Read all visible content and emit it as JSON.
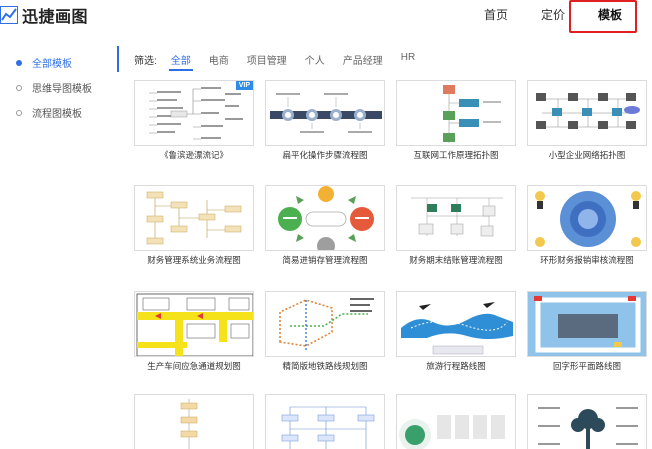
{
  "header": {
    "logo_text": "迅捷画图",
    "nav": {
      "home": "首页",
      "pricing": "定价",
      "templates": "模板"
    }
  },
  "sidebar": {
    "items": [
      {
        "label": "全部模板",
        "active": true
      },
      {
        "label": "思维导图模板",
        "active": false
      },
      {
        "label": "流程图模板",
        "active": false
      }
    ]
  },
  "filter": {
    "label": "筛选:",
    "tabs": [
      "全部",
      "电商",
      "项目管理",
      "个人",
      "产品经理",
      "HR"
    ],
    "active_index": 0
  },
  "templates": [
    {
      "title": "《鲁滨逊漂流记》",
      "vip": "VIP"
    },
    {
      "title": "扁平化操作步骤流程图"
    },
    {
      "title": "互联网工作原理拓扑图"
    },
    {
      "title": "小型企业网络拓扑图"
    },
    {
      "title": "财务管理系统业务流程图"
    },
    {
      "title": "简易进销存管理流程图"
    },
    {
      "title": "财务期末结账管理流程图"
    },
    {
      "title": "环形财务报销审核流程图"
    },
    {
      "title": "生产车间应急通道规划图"
    },
    {
      "title": "精简版地铁路线规划图"
    },
    {
      "title": "旅游行程路线图"
    },
    {
      "title": "回字形平面路线图"
    },
    {
      "title": ""
    },
    {
      "title": ""
    },
    {
      "title": ""
    },
    {
      "title": ""
    }
  ],
  "colors": {
    "accent": "#2f6fe6",
    "highlight_box": "#e02020"
  }
}
